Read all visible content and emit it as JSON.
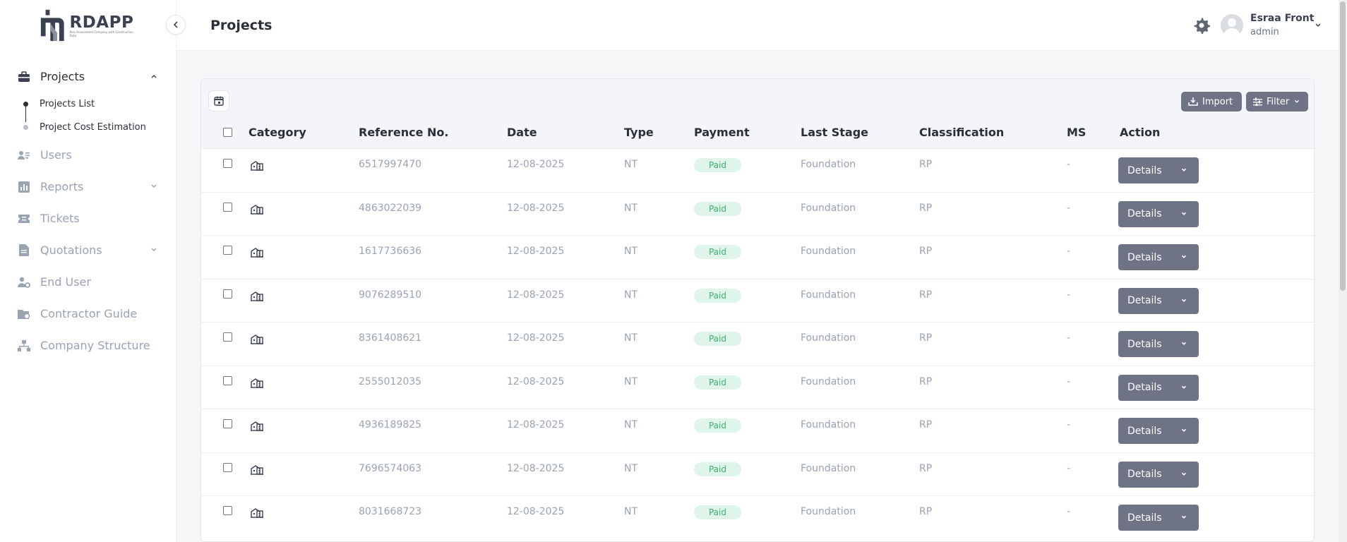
{
  "logo": {
    "brand": "RDAPP",
    "tagline": "Risk Assessment Company with Construction Data"
  },
  "sidebar": {
    "items": [
      {
        "label": "Projects",
        "icon": "briefcase-icon",
        "active": true,
        "expanded": true
      },
      {
        "label": "Users",
        "icon": "users-icon"
      },
      {
        "label": "Reports",
        "icon": "chart-icon",
        "expandable": true
      },
      {
        "label": "Tickets",
        "icon": "ticket-icon"
      },
      {
        "label": "Quotations",
        "icon": "document-icon",
        "expandable": true
      },
      {
        "label": "End User",
        "icon": "user-gear-icon"
      },
      {
        "label": "Contractor Guide",
        "icon": "guide-icon"
      },
      {
        "label": "Company Structure",
        "icon": "hierarchy-icon"
      }
    ],
    "sub_items": [
      "Projects List",
      "Project Cost Estimation"
    ]
  },
  "header": {
    "title": "Projects",
    "user_name": "Esraa Front",
    "user_role": "admin"
  },
  "toolbar": {
    "import_label": "Import",
    "filter_label": "Filter"
  },
  "table": {
    "columns": [
      "Category",
      "Reference No.",
      "Date",
      "Type",
      "Payment",
      "Last Stage",
      "Classification",
      "MS",
      "Action"
    ],
    "rows": [
      {
        "ref": "6517997470",
        "date": "12-08-2025",
        "type": "NT",
        "payment": "Paid",
        "stage": "Foundation",
        "class": "RP",
        "ms": "-",
        "action": "Details"
      },
      {
        "ref": "4863022039",
        "date": "12-08-2025",
        "type": "NT",
        "payment": "Paid",
        "stage": "Foundation",
        "class": "RP",
        "ms": "-",
        "action": "Details"
      },
      {
        "ref": "1617736636",
        "date": "12-08-2025",
        "type": "NT",
        "payment": "Paid",
        "stage": "Foundation",
        "class": "RP",
        "ms": "-",
        "action": "Details"
      },
      {
        "ref": "9076289510",
        "date": "12-08-2025",
        "type": "NT",
        "payment": "Paid",
        "stage": "Foundation",
        "class": "RP",
        "ms": "-",
        "action": "Details"
      },
      {
        "ref": "8361408621",
        "date": "12-08-2025",
        "type": "NT",
        "payment": "Paid",
        "stage": "Foundation",
        "class": "RP",
        "ms": "-",
        "action": "Details"
      },
      {
        "ref": "2555012035",
        "date": "12-08-2025",
        "type": "NT",
        "payment": "Paid",
        "stage": "Foundation",
        "class": "RP",
        "ms": "-",
        "action": "Details"
      },
      {
        "ref": "4936189825",
        "date": "12-08-2025",
        "type": "NT",
        "payment": "Paid",
        "stage": "Foundation",
        "class": "RP",
        "ms": "-",
        "action": "Details"
      },
      {
        "ref": "7696574063",
        "date": "12-08-2025",
        "type": "NT",
        "payment": "Paid",
        "stage": "Foundation",
        "class": "RP",
        "ms": "-",
        "action": "Details"
      },
      {
        "ref": "8031668723",
        "date": "12-08-2025",
        "type": "NT",
        "payment": "Paid",
        "stage": "Foundation",
        "class": "RP",
        "ms": "-",
        "action": "Details"
      }
    ]
  },
  "colors": {
    "accent_button": "#6e7486",
    "paid_bg": "#dff5ea",
    "paid_text": "#3fae6e",
    "muted_text": "#9aa3b2"
  }
}
